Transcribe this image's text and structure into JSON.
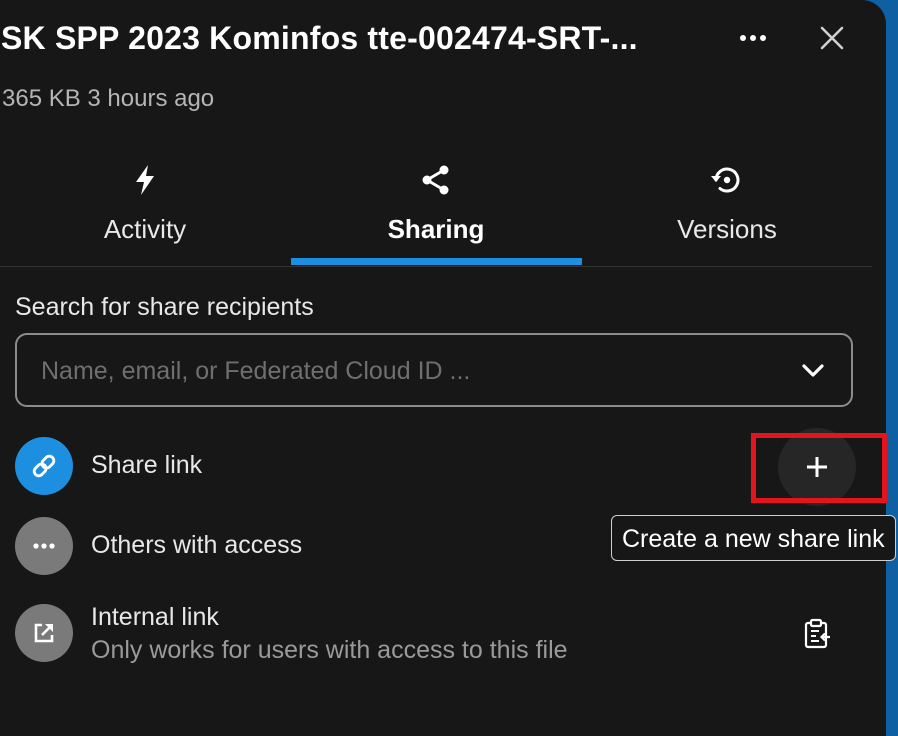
{
  "file": {
    "title": "SK SPP 2023 Kominfos tte-002474-SRT-...",
    "meta": "365 KB 3 hours ago"
  },
  "header": {
    "more_icon": "ellipsis-horizontal-icon",
    "close_icon": "close-icon"
  },
  "tabs": [
    {
      "label": "Activity",
      "icon": "lightning-icon",
      "active": false
    },
    {
      "label": "Sharing",
      "icon": "share-icon",
      "active": true
    },
    {
      "label": "Versions",
      "icon": "history-icon",
      "active": false
    }
  ],
  "sharing": {
    "search_label": "Search for share recipients",
    "search_placeholder": "Name, email, or Federated Cloud ID ...",
    "share_link": {
      "label": "Share link",
      "icon": "link-icon",
      "add_icon": "plus-icon",
      "tooltip": "Create a new share link"
    },
    "others": {
      "label": "Others with access",
      "icon": "ellipsis-horizontal-icon"
    },
    "internal": {
      "label": "Internal link",
      "sub": "Only works for users with access to this file",
      "icon": "external-link-icon",
      "copy_icon": "clipboard-icon"
    }
  },
  "colors": {
    "panel_bg": "#171717",
    "accent": "#1d8fe0",
    "highlight": "#e3141b",
    "side_bar": "#0f5fa3"
  }
}
